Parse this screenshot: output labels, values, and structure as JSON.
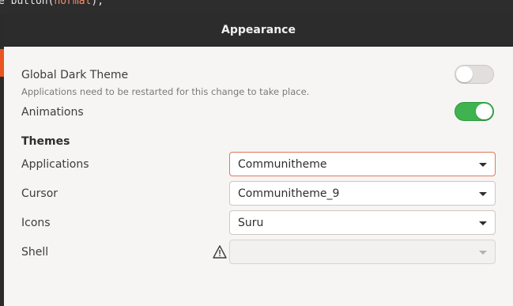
{
  "background": {
    "code_prefix": "e button(",
    "code_param": "normal",
    "code_suffix": ");"
  },
  "dialog": {
    "title": "Appearance"
  },
  "global_dark_theme": {
    "label": "Global Dark Theme",
    "note": "Applications need to be restarted for this change to take place.",
    "enabled": false
  },
  "animations": {
    "label": "Animations",
    "enabled": true
  },
  "themes": {
    "heading": "Themes",
    "applications": {
      "label": "Applications",
      "value": "Communitheme"
    },
    "cursor": {
      "label": "Cursor",
      "value": "Communitheme_9"
    },
    "icons": {
      "label": "Icons",
      "value": "Suru"
    },
    "shell": {
      "label": "Shell",
      "value": "",
      "warning_icon": "warning-icon"
    }
  },
  "colors": {
    "accent_orange": "#e95420",
    "switch_on": "#3eb34f",
    "focus_border": "#e2785a"
  }
}
